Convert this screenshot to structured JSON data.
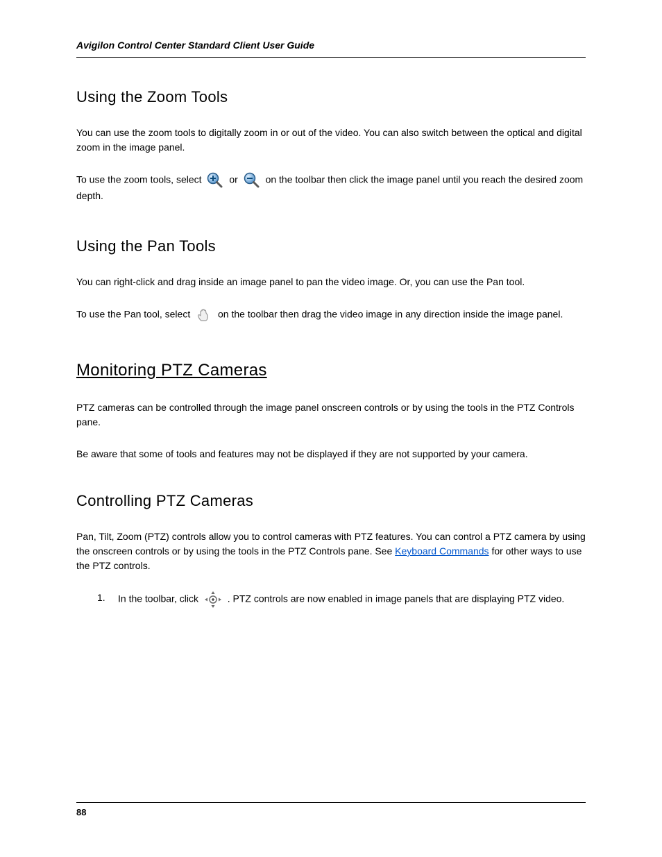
{
  "header": "Avigilon Control Center Standard Client User Guide",
  "sections": {
    "zoom": {
      "title": "Using the Zoom Tools",
      "intro": "You can use the zoom tools to digitally zoom in or out of the video. You can also switch between the optical and digital zoom in the image panel.",
      "p1a": "To use the zoom tools, select ",
      "p1b": " or ",
      "p1c": " on the toolbar then click the image panel until you reach the desired zoom depth."
    },
    "pan": {
      "title": "Using the Pan Tools",
      "intro": "You can right-click and drag inside an image panel to pan the video image. Or, you can use the Pan tool.",
      "p1a": "To use the Pan tool, select ",
      "p1b": " on the toolbar then drag the video image in any direction inside the image panel."
    },
    "ptz": {
      "title": "Monitoring PTZ Cameras",
      "intro": "PTZ cameras can be controlled through the image panel onscreen controls or by using the tools in the PTZ Controls pane.",
      "intro2": "Be aware that some of tools and features may not be displayed if they are not supported by your camera.",
      "ctrl_title": "Controlling PTZ Cameras",
      "ctrl_intro_a": "Pan, Tilt, Zoom (PTZ) controls allow you to control cameras with PTZ features. You can control a PTZ camera by using the onscreen controls or by using the tools in the PTZ Controls pane. See ",
      "ctrl_link": "Keyboard Commands",
      "ctrl_intro_b": " for other ways to use the PTZ controls.",
      "step1_number": "1.",
      "step1_a": "In the toolbar, click ",
      "step1_b": ". PTZ controls are now enabled in image panels that are displaying PTZ video."
    }
  },
  "page_number": "88"
}
